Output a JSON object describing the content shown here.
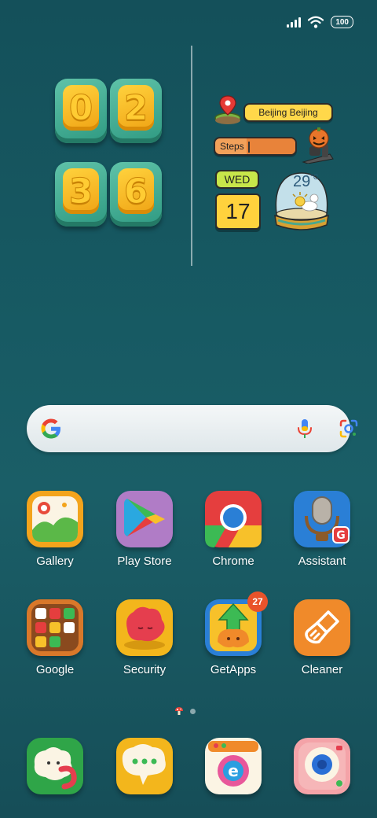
{
  "status": {
    "battery": "100",
    "signal_icon": "signal-bars-icon",
    "wifi_icon": "wifi-icon"
  },
  "clock_widget": {
    "h1": "0",
    "h2": "2",
    "m1": "3",
    "m2": "6"
  },
  "weather_widget": {
    "city": "Beijing Beijing",
    "steps_label": "Steps",
    "weekday": "WED",
    "date": "17",
    "temperature": "29",
    "unit": "°C"
  },
  "search": {
    "google_icon": "google-g-icon",
    "mic_icon": "microphone-icon",
    "lens_icon": "lens-icon"
  },
  "apps": [
    {
      "label": "Gallery"
    },
    {
      "label": "Play Store"
    },
    {
      "label": "Chrome"
    },
    {
      "label": "Assistant"
    },
    {
      "label": "Google"
    },
    {
      "label": "Security"
    },
    {
      "label": "GetApps",
      "badge": "27"
    },
    {
      "label": "Cleaner"
    }
  ],
  "colors": {
    "background": "#175a63",
    "accent_yellow": "#ffd23d",
    "accent_teal": "#3fab92"
  }
}
